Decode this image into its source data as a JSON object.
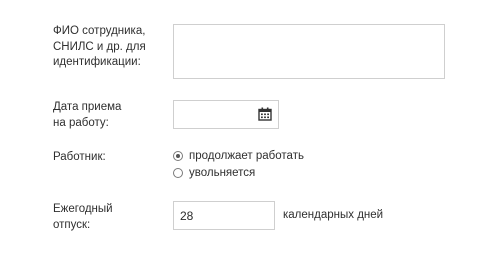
{
  "employee_field": {
    "label_lines": [
      "ФИО сотрудника,",
      "СНИЛС и др. для",
      "идентификации:"
    ],
    "value": ""
  },
  "hire_date": {
    "label_lines": [
      "Дата приема",
      "на работу:"
    ],
    "value": "",
    "icon": "calendar-icon"
  },
  "worker_status": {
    "label": "Работник:",
    "options": [
      {
        "label": "продолжает работать",
        "checked": true
      },
      {
        "label": "увольняется",
        "checked": false
      }
    ]
  },
  "vacation": {
    "label_lines": [
      "Ежегодный",
      "отпуск:"
    ],
    "value": "28",
    "suffix": "календарных дней"
  }
}
